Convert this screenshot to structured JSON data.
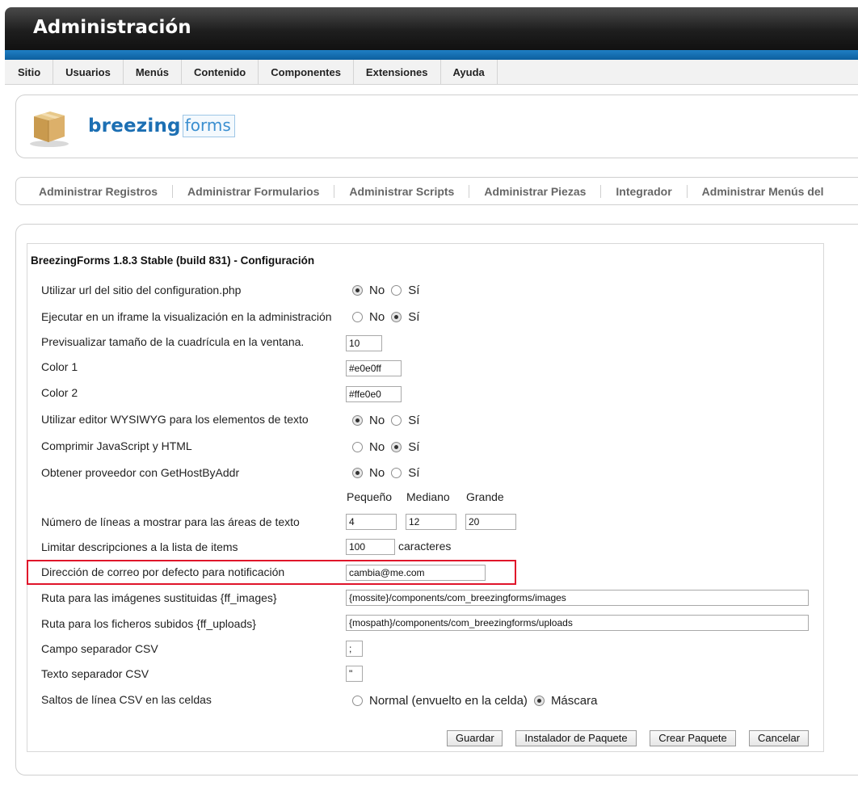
{
  "header": {
    "title": "Administración"
  },
  "menubar": {
    "items": [
      "Sitio",
      "Usuarios",
      "Menús",
      "Contenido",
      "Componentes",
      "Extensiones",
      "Ayuda"
    ]
  },
  "logo": {
    "brand_bold": "breezing",
    "brand_light": "forms"
  },
  "subnav": {
    "items": [
      "Administrar Registros",
      "Administrar Formularios",
      "Administrar Scripts",
      "Administrar Piezas",
      "Integrador",
      "Administrar Menús del"
    ]
  },
  "config": {
    "title": "BreezingForms 1.8.3 Stable (build 831) - Configuración",
    "rows": {
      "use_url": {
        "label": "Utilizar url del sitio del configuration.php",
        "selected": "No"
      },
      "iframe": {
        "label": "Ejecutar en un iframe la visualización en la administración",
        "selected": "Sí"
      },
      "grid_size": {
        "label": "Previsualizar tamaño de la cuadrícula en la ventana.",
        "value": "10"
      },
      "color1": {
        "label": "Color 1",
        "value": "#e0e0ff"
      },
      "color2": {
        "label": "Color 2",
        "value": "#ffe0e0"
      },
      "wysiwyg": {
        "label": "Utilizar editor WYSIWYG para los elementos de texto",
        "selected": "No"
      },
      "compress": {
        "label": "Comprimir JavaScript y HTML",
        "selected": "Sí"
      },
      "gethost": {
        "label": "Obtener proveedor con GetHostByAddr",
        "selected": "No"
      },
      "textarea_lines": {
        "label": "Número de líneas a mostrar para las áreas de texto",
        "col_small": "Pequeño",
        "col_medium": "Mediano",
        "col_large": "Grande",
        "small": "4",
        "medium": "12",
        "large": "20"
      },
      "desc_limit": {
        "label": "Limitar descripciones a la lista de items",
        "value": "100",
        "suffix": "caracteres"
      },
      "email": {
        "label": "Dirección de correo por defecto para notificación",
        "value": "cambia@me.com"
      },
      "images_path": {
        "label": "Ruta para las imágenes sustituidas {ff_images}",
        "value": "{mossite}/components/com_breezingforms/images"
      },
      "uploads_path": {
        "label": "Ruta para los ficheros subidos {ff_uploads}",
        "value": "{mospath}/components/com_breezingforms/uploads"
      },
      "csv_sep": {
        "label": "Campo separador CSV",
        "value": ";"
      },
      "csv_text": {
        "label": "Texto separador CSV",
        "value": "\""
      },
      "csv_newlines": {
        "label": "Saltos de línea CSV en las celdas",
        "opt_a": "Normal (envuelto en la celda)",
        "opt_b": "Máscara",
        "selected": "Máscara"
      }
    },
    "radio_no": "No",
    "radio_yes": "Sí"
  },
  "buttons": {
    "save": "Guardar",
    "installer": "Instalador de Paquete",
    "create": "Crear Paquete",
    "cancel": "Cancelar"
  },
  "colors": {
    "header_accent": "#1f7fc4",
    "highlight": "#e0142a",
    "brand": "#1c6fb3"
  }
}
